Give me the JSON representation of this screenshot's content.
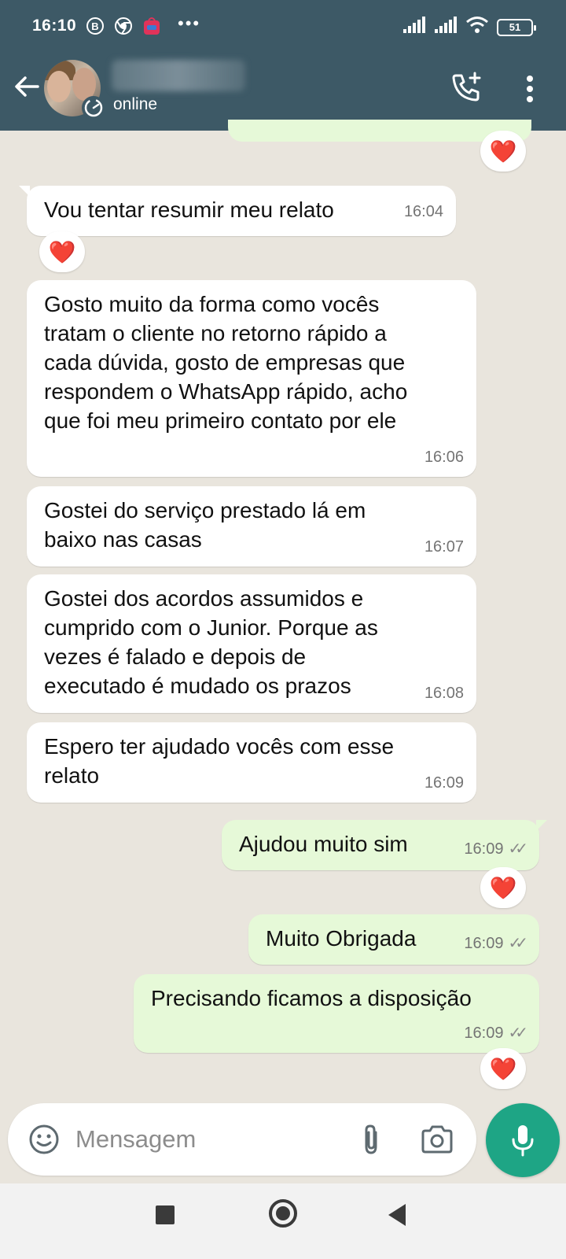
{
  "status_bar": {
    "time": "16:10",
    "more_indicator": "•••",
    "battery": "51"
  },
  "header": {
    "contact_status": "online"
  },
  "messages": [
    {
      "text": "Vou tentar resumir meu relato",
      "time": "16:04",
      "direction": "in",
      "reaction": "❤️"
    },
    {
      "text": "Gosto muito da forma como vocês\ntratam o cliente no retorno rápido a\ncada dúvida, gosto de empresas que\nrespondem o WhatsApp rápido, acho\nque foi meu primeiro contato por ele",
      "time": "16:06",
      "direction": "in"
    },
    {
      "text": "Gostei do serviço prestado lá em\nbaixo nas casas",
      "time": "16:07",
      "direction": "in"
    },
    {
      "text": "Gostei dos acordos assumidos e\ncumprido com o Junior. Porque as\nvezes é falado e depois de\nexecutado é mudado os prazos",
      "time": "16:08",
      "direction": "in"
    },
    {
      "text": "Espero ter ajudado vocês com esse\nrelato",
      "time": "16:09",
      "direction": "in"
    },
    {
      "text": "Ajudou muito sim",
      "time": "16:09",
      "direction": "out",
      "reaction": "❤️"
    },
    {
      "text": "Muito Obrigada",
      "time": "16:09",
      "direction": "out"
    },
    {
      "text": "Precisando ficamos a disposição",
      "time": "16:09",
      "direction": "out",
      "reaction": "❤️"
    }
  ],
  "top_reaction": "❤️",
  "composer": {
    "placeholder": "Mensagem"
  },
  "icons": {
    "back": "arrow-left-icon",
    "call": "add-call-icon",
    "menu": "more-vert-icon",
    "emoji": "emoji-icon",
    "attach": "paperclip-icon",
    "camera": "camera-icon",
    "mic": "microphone-icon"
  },
  "colors": {
    "header": "#3d5966",
    "chat_background": "#e9e5dd",
    "outgoing_bubble": "#e6f9d8",
    "mic_button": "#1ea585",
    "reaction_heart": "#e0242c"
  }
}
